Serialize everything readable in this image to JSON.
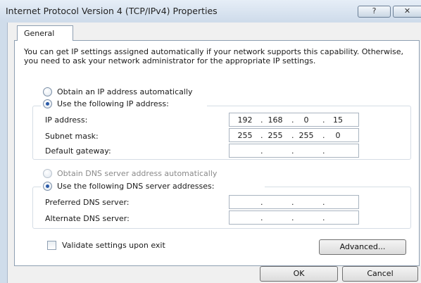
{
  "window": {
    "title": "Internet Protocol Version 4 (TCP/IPv4) Properties",
    "help_glyph": "?",
    "close_glyph": "✕"
  },
  "tabs": [
    {
      "label": "General",
      "selected": true
    }
  ],
  "description": "You can get IP settings assigned automatically if your network supports this capability. Otherwise, you need to ask your network administrator for the appropriate IP settings.",
  "ip_section": {
    "auto_label": "Obtain an IP address automatically",
    "manual_label": "Use the following IP address:",
    "selected": "manual",
    "fields": [
      {
        "label": "IP address:",
        "octets": [
          "192",
          "168",
          "0",
          "15"
        ]
      },
      {
        "label": "Subnet mask:",
        "octets": [
          "255",
          "255",
          "255",
          "0"
        ]
      },
      {
        "label": "Default gateway:",
        "octets": [
          "",
          "",
          "",
          ""
        ]
      }
    ]
  },
  "dns_section": {
    "auto_label": "Obtain DNS server address automatically",
    "manual_label": "Use the following DNS server addresses:",
    "selected": "manual",
    "fields": [
      {
        "label": "Preferred DNS server:",
        "octets": [
          "",
          "",
          "",
          ""
        ]
      },
      {
        "label": "Alternate DNS server:",
        "octets": [
          "",
          "",
          "",
          ""
        ]
      }
    ]
  },
  "validate": {
    "label": "Validate settings upon exit",
    "checked": false
  },
  "buttons": {
    "advanced": "Advanced...",
    "ok": "OK",
    "cancel": "Cancel"
  },
  "ip_separator": "."
}
